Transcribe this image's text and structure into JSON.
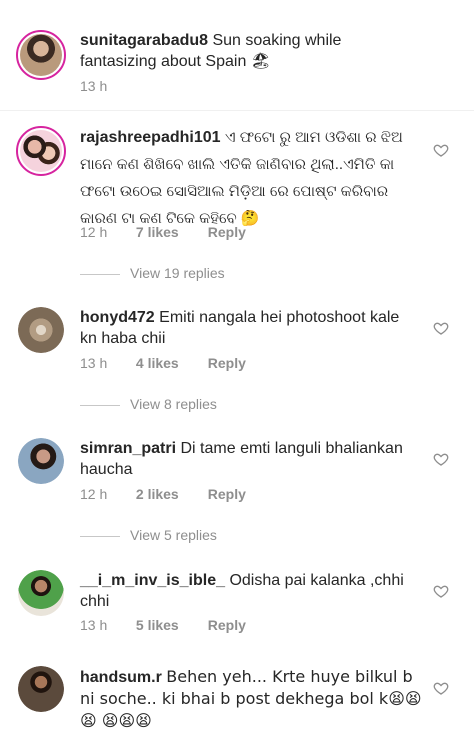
{
  "comments": [
    {
      "username": "sunitagarabadu8",
      "text": "Sun soaking while fantasizing about Spain 🏖",
      "time": "13 h",
      "likes": "",
      "reply": ""
    },
    {
      "username": "rajashreepadhi101",
      "text": "ଏ ଫଟୋ ରୁ ଆମ ଓଡିଶା ର ଝିଅ ମାନେ କଣ ଶିଖିବେ ଖାଲି ଏତିକି ଜାଣିବାର ଥିଲା..ଏମିତି କା ଫଟୋ ଉଠେଇ ସୋସିଆଲ ମିଡ଼ିଆ ରେ ପୋଷ୍ଟ କରିବାର କାରଣ ଟା କଣ ଟିକେ କହିବେ 🤔",
      "time": "12 h",
      "likes": "7 likes",
      "reply": "Reply",
      "view_replies": "View 19 replies"
    },
    {
      "username": "honyd472",
      "text": "Emiti nangala hei photoshoot kale kn haba chii",
      "time": "13 h",
      "likes": "4 likes",
      "reply": "Reply",
      "view_replies": "View 8 replies"
    },
    {
      "username": "simran_patri",
      "text": "Di tame emti languli bhaliankan haucha",
      "time": "12 h",
      "likes": "2 likes",
      "reply": "Reply",
      "view_replies": "View 5 replies"
    },
    {
      "username": "__i_m_inv_is_ible_",
      "text": "Odisha pai kalanka ,chhi chhi",
      "time": "13 h",
      "likes": "5 likes",
      "reply": "Reply"
    },
    {
      "username": "handsum.r",
      "text": "Behen yeh... Krte huye bilkul b ni soche.. ki bhai b post dekhega bol k😫😫😫 😫😫😫",
      "time": "",
      "likes": "",
      "reply": ""
    }
  ],
  "icons": {
    "heart": "heart-outline-icon"
  },
  "colors": {
    "avatar_ring": "#d6249f",
    "meta_text": "#8e8e8e",
    "primary_text": "#262626"
  }
}
